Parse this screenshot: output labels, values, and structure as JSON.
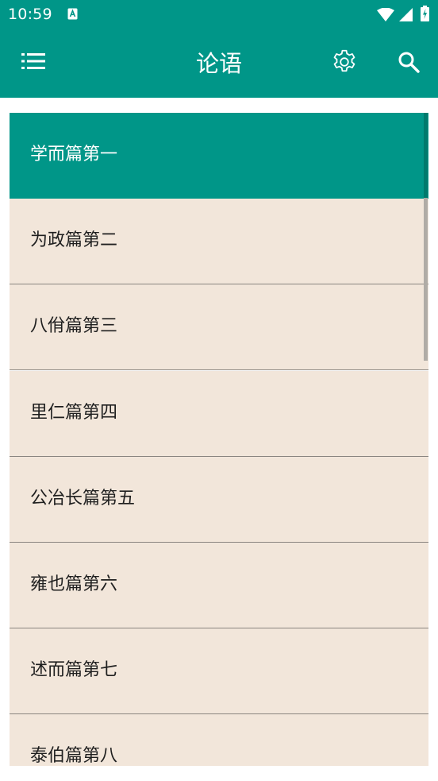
{
  "status_bar": {
    "time": "10:59",
    "notification_icon": "a-letter-notification-icon",
    "wifi_icon": "wifi-icon",
    "signal_icon": "cell-signal-icon",
    "battery_icon": "battery-charging-icon"
  },
  "app_bar": {
    "title": "论语",
    "menu_icon": "menu-icon",
    "settings_icon": "settings-gear-icon",
    "search_icon": "search-icon",
    "color": "#009688"
  },
  "chapters": [
    {
      "label": "学而篇第一",
      "selected": true
    },
    {
      "label": "为政篇第二",
      "selected": false
    },
    {
      "label": "八佾篇第三",
      "selected": false
    },
    {
      "label": "里仁篇第四",
      "selected": false
    },
    {
      "label": "公冶长篇第五",
      "selected": false
    },
    {
      "label": "雍也篇第六",
      "selected": false
    },
    {
      "label": "述而篇第七",
      "selected": false
    },
    {
      "label": "泰伯篇第八",
      "selected": false
    }
  ],
  "colors": {
    "accent": "#009688",
    "item_background": "#f2e6da",
    "divider": "#8a8580"
  }
}
